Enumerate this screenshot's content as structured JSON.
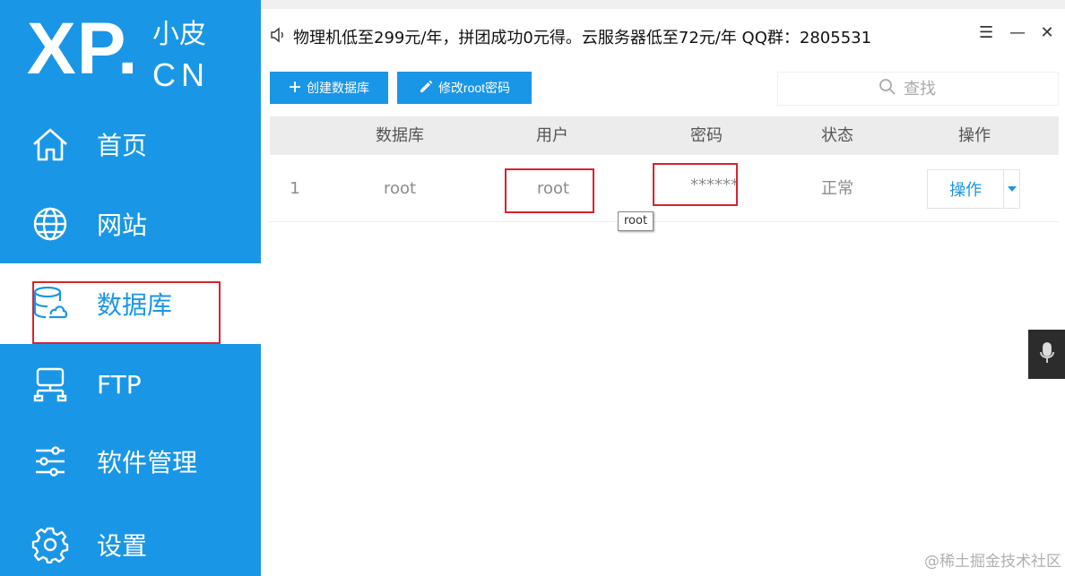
{
  "logo": {
    "main": "XP.",
    "sub": "小皮",
    "cn": "CN"
  },
  "sidebar": {
    "items": [
      {
        "label": "首页",
        "icon": "home-icon"
      },
      {
        "label": "网站",
        "icon": "globe-icon"
      },
      {
        "label": "数据库",
        "icon": "database-icon",
        "active": true
      },
      {
        "label": "FTP",
        "icon": "ftp-icon"
      },
      {
        "label": "软件管理",
        "icon": "sliders-icon"
      },
      {
        "label": "设置",
        "icon": "gear-icon"
      }
    ]
  },
  "notice": {
    "text": "物理机低至299元/年，拼团成功0元得。云服务器低至72元/年  QQ群：2805531",
    "icon": "speaker-icon"
  },
  "window_controls": {
    "menu": "☰",
    "minimize": "—",
    "close": "✕"
  },
  "toolbar": {
    "create_label": "创建数据库",
    "change_password_label": "修改root密码"
  },
  "search": {
    "placeholder": "查找"
  },
  "table": {
    "headers": [
      "数据库",
      "用户",
      "密码",
      "状态",
      "操作"
    ],
    "rows": [
      {
        "index": "1",
        "database": "root",
        "user": "root",
        "password": "******",
        "status": "正常",
        "action": "操作"
      }
    ]
  },
  "tooltip": {
    "text": "root"
  },
  "watermark": "@稀土掘金技术社区",
  "colors": {
    "primary": "#1a96e6",
    "highlight": "#d9232e",
    "header_bg": "#ececec"
  }
}
